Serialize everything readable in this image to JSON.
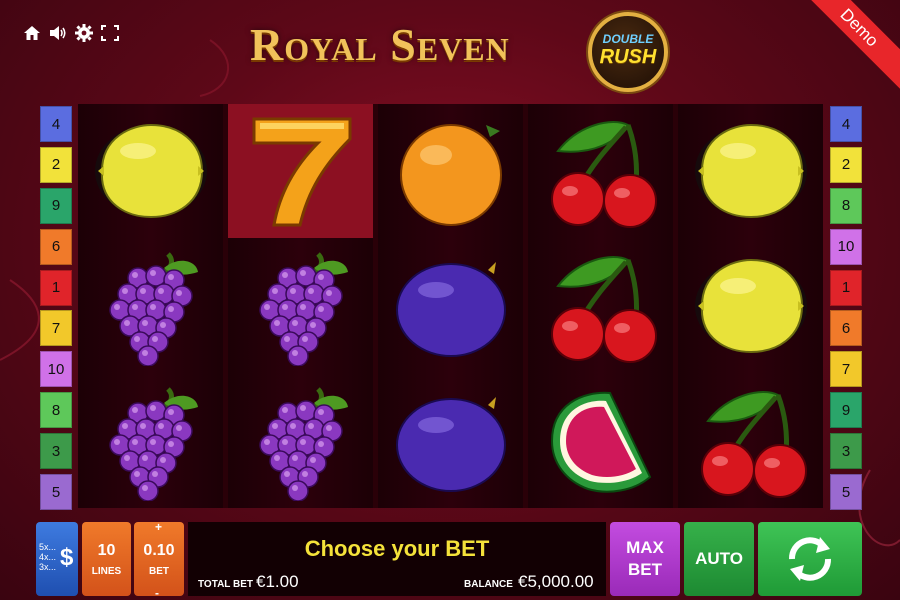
{
  "game": {
    "title": "Royal Seven",
    "badge_line1": "DOUBLE",
    "badge_line2": "RUSH",
    "demo_label": "Demo"
  },
  "toolbar": {
    "icons": [
      "home-icon",
      "speaker-icon",
      "gear-icon",
      "fullscreen-icon"
    ]
  },
  "paylines": {
    "left": [
      "4",
      "2",
      "9",
      "6",
      "1",
      "7",
      "10",
      "8",
      "3",
      "5"
    ],
    "right": [
      "4",
      "2",
      "8",
      "10",
      "1",
      "6",
      "7",
      "9",
      "3",
      "5"
    ]
  },
  "reels": [
    [
      "lemon",
      "grapes",
      "grapes"
    ],
    [
      "seven",
      "grapes",
      "grapes"
    ],
    [
      "orange",
      "plum",
      "plum"
    ],
    [
      "cherry",
      "cherry",
      "watermelon"
    ],
    [
      "lemon",
      "lemon",
      "cherry"
    ]
  ],
  "controls": {
    "coin_multipliers": [
      "5x...",
      "4x...",
      "3x..."
    ],
    "coin_symbol": "$",
    "lines_value": "10",
    "lines_label": "LINES",
    "bet_value": "0.10",
    "bet_label": "BET",
    "bet_plus": "+",
    "bet_minus": "-",
    "message": "Choose your BET",
    "total_bet_label": "TOTAL BET",
    "total_bet_value": "€1.00",
    "balance_label": "BALANCE",
    "balance_value": "€5,000.00",
    "max_bet_label": "MAX BET",
    "auto_label": "AUTO"
  },
  "colors": {
    "payline_left": [
      "#5b6de0",
      "#f2e23a",
      "#2aa56a",
      "#f07a2a",
      "#e0242a",
      "#f2c82a",
      "#d071e8",
      "#5ec85a",
      "#3d9a4a",
      "#9a6ad0"
    ],
    "payline_right": [
      "#5b6de0",
      "#f2e23a",
      "#5ec85a",
      "#d071e8",
      "#e0242a",
      "#f07a2a",
      "#f2c82a",
      "#2aa56a",
      "#3d9a4a",
      "#9a6ad0"
    ]
  }
}
